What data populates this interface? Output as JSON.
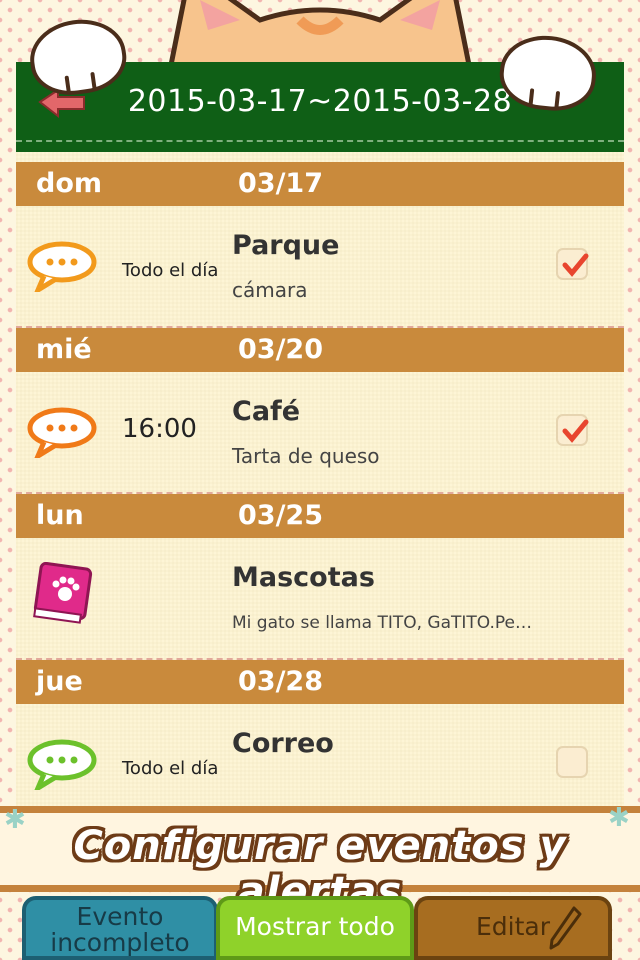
{
  "header": {
    "title": "2015-03-17~2015-03-28",
    "back_icon": "back-arrow-icon"
  },
  "groups": [
    {
      "day": "dom",
      "date": "03/17",
      "event": {
        "icon": "speech-bubble-icon",
        "icon_color": "#f29a1c",
        "time": "Todo el día",
        "title": "Parque",
        "subtitle": "cámara",
        "checked": true
      }
    },
    {
      "day": "mié",
      "date": "03/20",
      "event": {
        "icon": "speech-bubble-icon",
        "icon_color": "#f07a18",
        "time": "16:00",
        "title": "Café",
        "subtitle": "Tarta de queso",
        "checked": true
      }
    },
    {
      "day": "lun",
      "date": "03/25",
      "event": {
        "icon": "paw-book-icon",
        "icon_color": "#e02a8a",
        "time": "",
        "title": "Mascotas",
        "subtitle": "Mi gato se llama TITO, GaTITO.Pe…",
        "checked": null
      }
    },
    {
      "day": "jue",
      "date": "03/28",
      "event": {
        "icon": "speech-bubble-icon",
        "icon_color": "#6cc12b",
        "time": "Todo el día",
        "title": "Correo",
        "subtitle": "",
        "checked": false
      }
    }
  ],
  "banner": {
    "text": "Configurar eventos y alertas"
  },
  "tabs": {
    "incomplete_line1": "Evento",
    "incomplete_line2": "incompleto",
    "show_all": "Mostrar todo",
    "edit": "Editar",
    "edit_icon": "pencil-icon"
  },
  "colors": {
    "header_green": "#0f5f16",
    "day_bar": "#c98a3c",
    "check_red": "#e8452e"
  }
}
